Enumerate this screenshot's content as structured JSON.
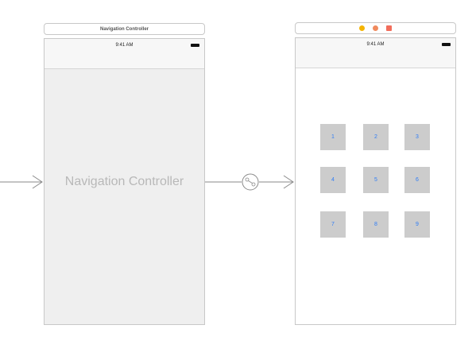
{
  "navigation_scene": {
    "header_title": "Navigation Controller",
    "status_time": "9:41 AM",
    "placeholder": "Navigation Controller"
  },
  "view_scene": {
    "dock_icons": [
      "view-controller-icon",
      "first-responder-icon",
      "exit-icon"
    ],
    "dock_colors": [
      "#f5b400",
      "#f08a5d",
      "#f26d5b"
    ],
    "status_time": "9:41 AM",
    "buttons": [
      "1",
      "2",
      "3",
      "4",
      "5",
      "6",
      "7",
      "8",
      "9"
    ],
    "button_text_color": "#2f7df6"
  },
  "segue": {
    "icon": "relationship-segue-icon"
  }
}
